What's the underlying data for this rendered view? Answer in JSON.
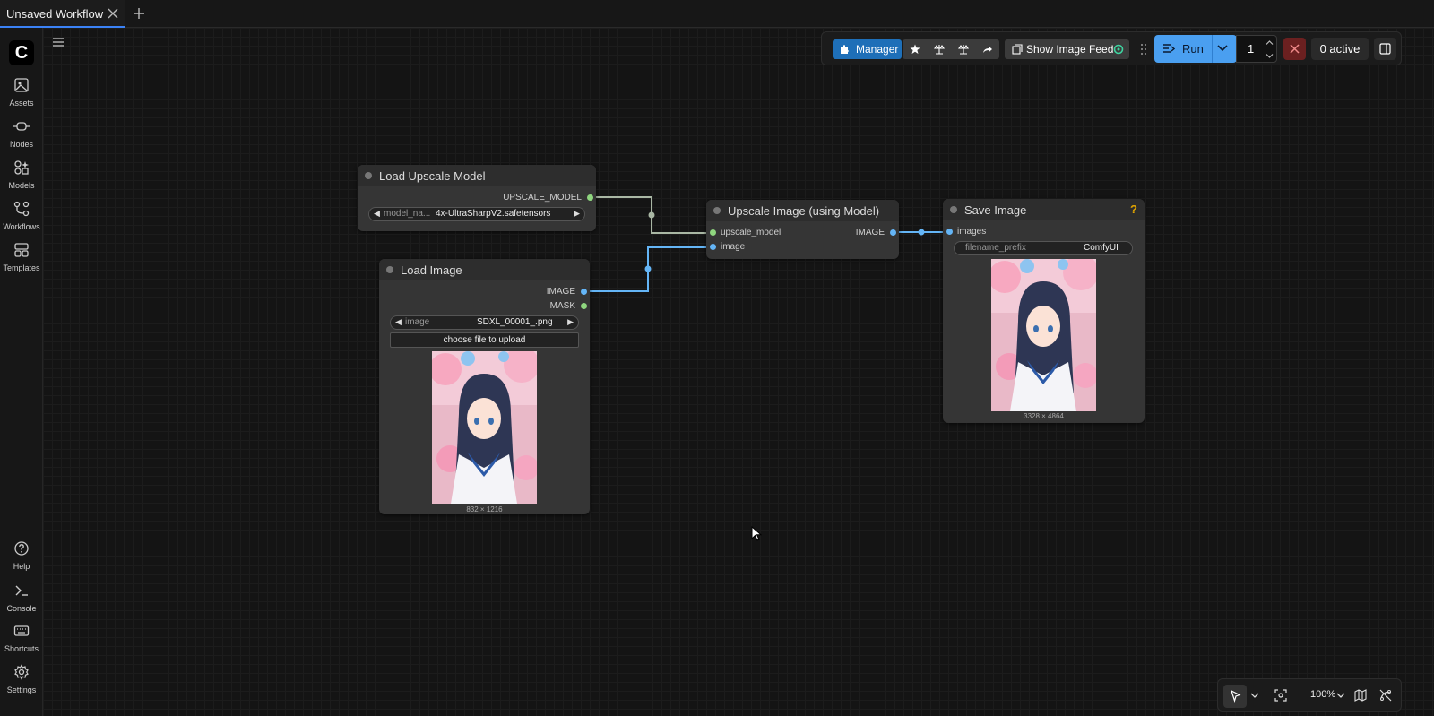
{
  "tabs": [
    {
      "label": "Unsaved Workflow"
    }
  ],
  "sidebar": {
    "top_items": [
      {
        "label": "Assets",
        "icon": "image-icon"
      },
      {
        "label": "Nodes",
        "icon": "node-icon"
      },
      {
        "label": "Models",
        "icon": "models-icon"
      },
      {
        "label": "Workflows",
        "icon": "workflow-icon"
      },
      {
        "label": "Templates",
        "icon": "templates-icon"
      }
    ],
    "bottom_items": [
      {
        "label": "Help",
        "icon": "help-icon"
      },
      {
        "label": "Console",
        "icon": "console-icon"
      },
      {
        "label": "Shortcuts",
        "icon": "keyboard-icon"
      },
      {
        "label": "Settings",
        "icon": "gear-icon"
      }
    ]
  },
  "toolbar": {
    "manager_label": "Manager",
    "show_image_feed_label": "Show Image Feed",
    "run_label": "Run",
    "batch_count": "1",
    "active_label": "0 active"
  },
  "nodes": {
    "load_upscale_model": {
      "title": "Load Upscale Model",
      "output": "UPSCALE_MODEL",
      "widget_label": "model_na...",
      "widget_value": "4x-UltraSharpV2.safetensors"
    },
    "load_image": {
      "title": "Load Image",
      "outputs": [
        "IMAGE",
        "MASK"
      ],
      "widget_label": "image",
      "widget_value": "SDXL_00001_.png",
      "upload_label": "choose file to upload",
      "dims": "832 × 1216"
    },
    "upscale_image": {
      "title": "Upscale Image (using Model)",
      "inputs": [
        "upscale_model",
        "image"
      ],
      "output": "IMAGE"
    },
    "save_image": {
      "title": "Save Image",
      "input": "images",
      "widget_label": "filename_prefix",
      "widget_value": "ComfyUI",
      "help_label": "?",
      "dims": "3328 × 4864"
    }
  },
  "zoom": "100%",
  "colors": {
    "accent": "#4a9ff0",
    "manager": "#1e6fb8",
    "image_port": "#64b5f6",
    "model_port": "#8fd67f",
    "link_model": "#a9b7a4",
    "link_image": "#64b5f6"
  }
}
